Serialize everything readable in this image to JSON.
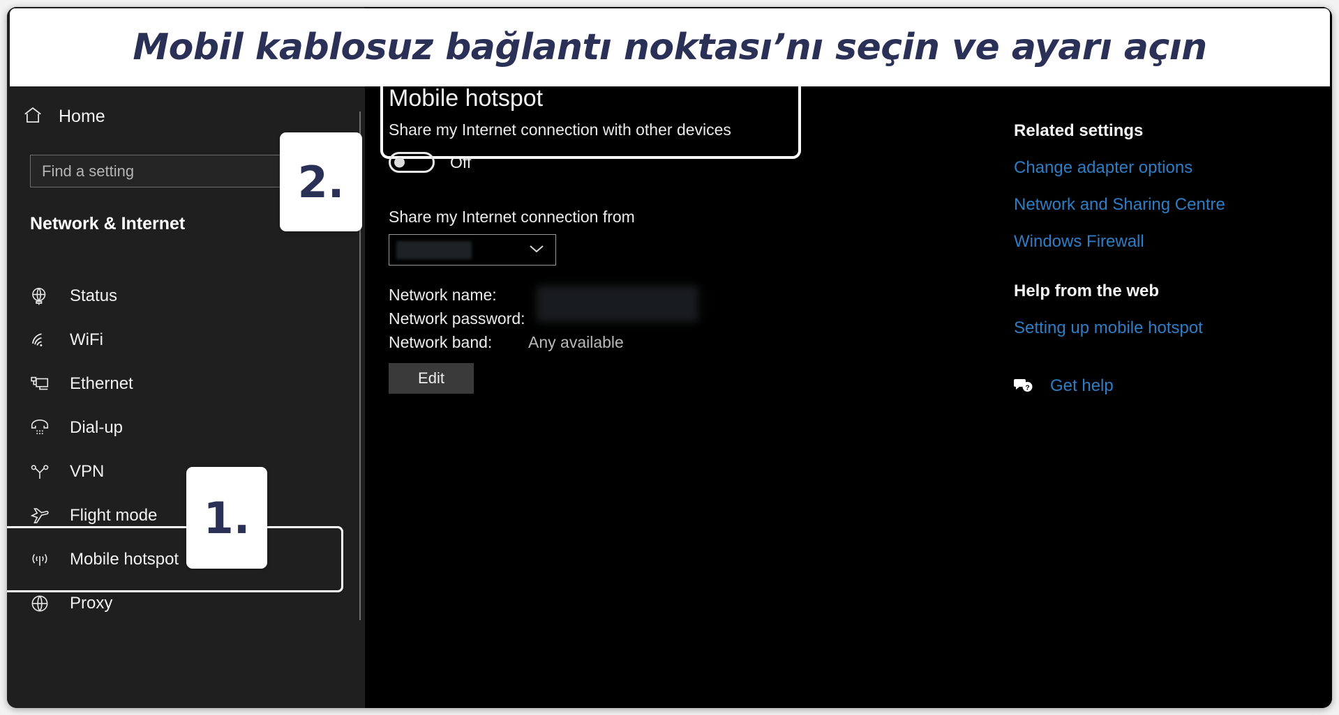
{
  "banner": {
    "text": "Mobil kablosuz bağlantı noktası’nı seçin ve ayarı açın",
    "color": "#2b3057"
  },
  "callouts": [
    {
      "label": "1."
    },
    {
      "label": "2."
    }
  ],
  "sidebar": {
    "home": {
      "label": "Home",
      "icon": "home-icon"
    },
    "search": {
      "placeholder": "Find a setting",
      "value": ""
    },
    "section_title": "Network & Internet",
    "items": [
      {
        "label": "Status",
        "icon": "globe-monitor-icon",
        "selected": false
      },
      {
        "label": "WiFi",
        "icon": "wifi-icon",
        "selected": false
      },
      {
        "label": "Ethernet",
        "icon": "ethernet-icon",
        "selected": false
      },
      {
        "label": "Dial-up",
        "icon": "dialup-icon",
        "selected": false
      },
      {
        "label": "VPN",
        "icon": "vpn-icon",
        "selected": false
      },
      {
        "label": "Flight mode",
        "icon": "airplane-icon",
        "selected": false
      },
      {
        "label": "Mobile hotspot",
        "icon": "hotspot-icon",
        "selected": true
      },
      {
        "label": "Proxy",
        "icon": "globe-icon",
        "selected": false
      }
    ],
    "accent_color": "#2d6fae"
  },
  "main": {
    "heading": "Mobile hotspot",
    "share_toggle": {
      "label": "Share my Internet connection with other devices",
      "state": "Off",
      "on": false
    },
    "share_from": {
      "label": "Share my Internet connection from",
      "value": "",
      "redacted": true,
      "chevron": "chevron-down-icon"
    },
    "details": [
      {
        "key": "Network name:",
        "value": "",
        "redacted": true
      },
      {
        "key": "Network password:",
        "value": "",
        "redacted": true
      },
      {
        "key": "Network band:",
        "value": "Any available",
        "redacted": false
      }
    ],
    "edit_button": "Edit"
  },
  "right_column": {
    "related": {
      "heading": "Related settings",
      "links": [
        "Change adapter options",
        "Network and Sharing Centre",
        "Windows Firewall"
      ]
    },
    "help": {
      "heading": "Help from the web",
      "links": [
        "Setting up mobile hotspot"
      ]
    },
    "get_help": {
      "label": "Get help",
      "icon": "speech-question-icon"
    },
    "link_color": "#2f7dc4"
  }
}
